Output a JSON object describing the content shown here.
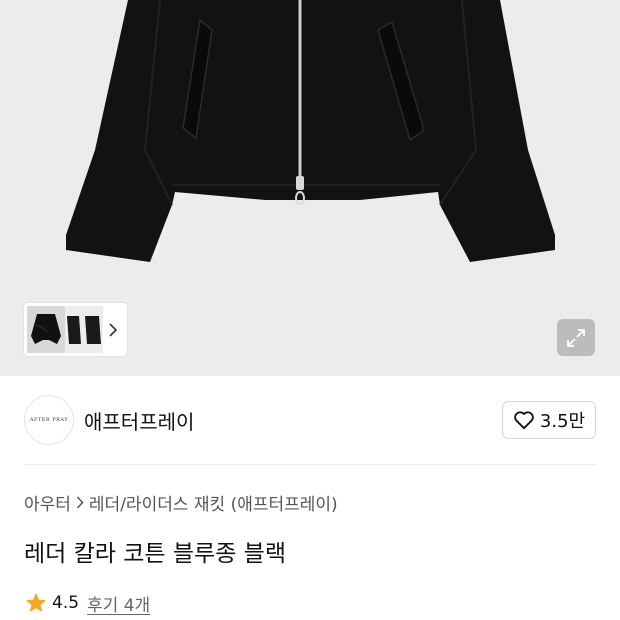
{
  "product": {
    "image_alt": "black jacket",
    "thumbnail_count": 2,
    "expand_icon": "expand-arrows-icon"
  },
  "brand": {
    "logo_text": "AFTER PRAY",
    "name": "애프터프레이",
    "like_count": "3.5만"
  },
  "breadcrumb": {
    "items": [
      "아우터",
      "레더/라이더스 재킷 (애프터프레이)"
    ]
  },
  "title": "레더 칼라 코튼 블루종 블랙",
  "rating": {
    "score": "4.5",
    "reviews_label": "후기 4개",
    "star_color": "#f5a623"
  }
}
